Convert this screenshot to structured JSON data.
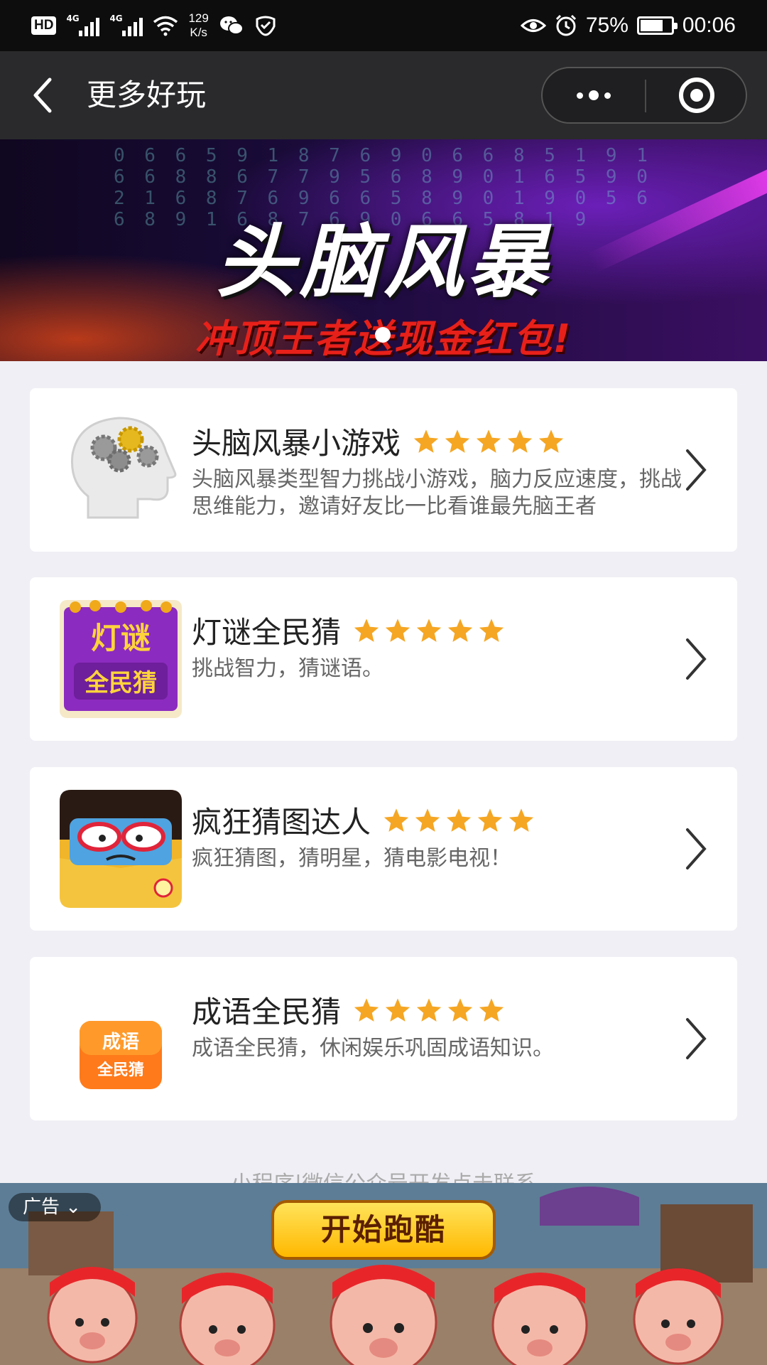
{
  "status_bar": {
    "hd": "HD",
    "signal_1": "4G",
    "signal_2": "4G",
    "net_speed_value": "129",
    "net_speed_unit": "K/s",
    "battery_percent": "75%",
    "battery_level": 0.75,
    "time": "00:06"
  },
  "nav": {
    "title": "更多好玩"
  },
  "banner": {
    "title": "头脑风暴",
    "subtitle": "冲顶王者送现金红包!",
    "digits": "0 6 6 5 9 1 8 7 6 9 0 6 6 8 5 1 9 1 6 6 8 8 6 7 7 9 5 6 8 9 0 1 6 5 9 0 2 1 6 8 7 6 9 6 6 5 8 9 0 1 9 0 5 6 6 8 9 1 6 8 7 6 9 0 6 6 5 8 1 9"
  },
  "items": [
    {
      "title": "头脑风暴小游戏",
      "rating": 5,
      "desc": "头脑风暴类型智力挑战小游戏，脑力反应速度，挑战思维能力，邀请好友比一比看谁最先脑王者"
    },
    {
      "title": "灯谜全民猜",
      "rating": 5,
      "desc": "挑战智力，猜谜语。",
      "icon_text_top": "灯谜",
      "icon_text_bottom": "全民猜"
    },
    {
      "title": "疯狂猜图达人",
      "rating": 5,
      "desc": "疯狂猜图，猜明星，猜电影电视！"
    },
    {
      "title": "成语全民猜",
      "rating": 5,
      "desc": "成语全民猜，休闲娱乐巩固成语知识。",
      "icon_text_top": "成语",
      "icon_text_bottom": "全民猜"
    }
  ],
  "footer": {
    "text": "小程序|微信公众号开发点击联系"
  },
  "ad": {
    "label": "广告",
    "button": "开始跑酷"
  },
  "colors": {
    "star": "#f5a623",
    "status_bg": "#0d0d0d",
    "nav_bg": "#2a2a2c",
    "page_bg": "#f0eff5"
  }
}
